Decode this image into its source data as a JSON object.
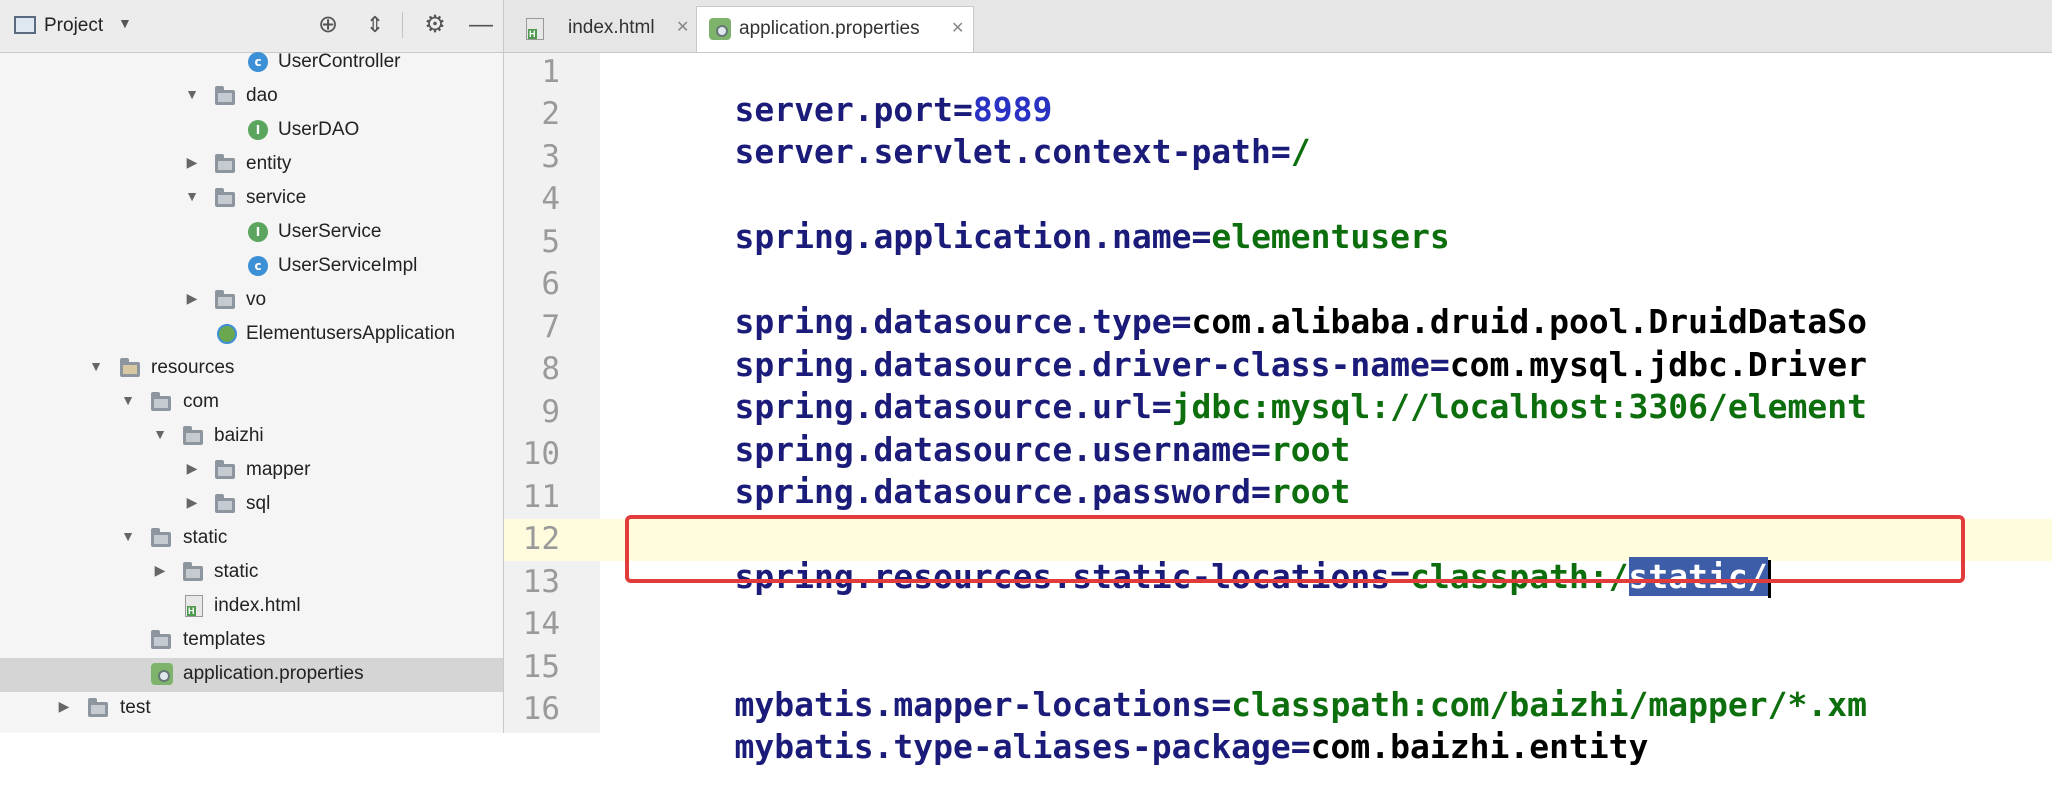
{
  "sidebar": {
    "title": "Project",
    "tree": [
      {
        "label": "UserController",
        "icon": "class-icon",
        "level": 3
      },
      {
        "label": "dao",
        "icon": "folder-icon",
        "level": 2,
        "expanded": true
      },
      {
        "label": "UserDAO",
        "icon": "interface-icon",
        "level": 3
      },
      {
        "label": "entity",
        "icon": "folder-icon",
        "level": 2,
        "expanded": false
      },
      {
        "label": "service",
        "icon": "folder-icon",
        "level": 2,
        "expanded": true
      },
      {
        "label": "UserService",
        "icon": "interface-icon",
        "level": 3
      },
      {
        "label": "UserServiceImpl",
        "icon": "class-icon",
        "level": 3
      },
      {
        "label": "vo",
        "icon": "folder-icon",
        "level": 2,
        "expanded": false
      },
      {
        "label": "ElementusersApplication",
        "icon": "spring-app-icon",
        "level": 2
      },
      {
        "label": "resources",
        "icon": "resources-folder-icon",
        "level": 0,
        "expanded": true
      },
      {
        "label": "com",
        "icon": "folder-icon",
        "level": 1,
        "expanded": true
      },
      {
        "label": "baizhi",
        "icon": "folder-icon",
        "level": 2,
        "expanded": true
      },
      {
        "label": "mapper",
        "icon": "folder-icon",
        "level": 3,
        "expanded": false
      },
      {
        "label": "sql",
        "icon": "folder-icon",
        "level": 3,
        "expanded": false
      },
      {
        "label": "static",
        "icon": "folder-icon",
        "level": 1,
        "expanded": true
      },
      {
        "label": "static",
        "icon": "folder-icon",
        "level": 2,
        "expanded": false
      },
      {
        "label": "index.html",
        "icon": "html-file-icon",
        "level": 2
      },
      {
        "label": "templates",
        "icon": "folder-icon",
        "level": 1
      },
      {
        "label": "application.properties",
        "icon": "properties-file-icon",
        "level": 1,
        "selected": true
      },
      {
        "label": "test",
        "icon": "folder-icon",
        "level": -1,
        "expanded": false
      }
    ]
  },
  "tabs": [
    {
      "label": "index.html",
      "active": false
    },
    {
      "label": "application.properties",
      "active": true
    }
  ],
  "editor": {
    "line_numbers": [
      "1",
      "2",
      "3",
      "4",
      "5",
      "6",
      "7",
      "8",
      "9",
      "10",
      "11",
      "12",
      "13",
      "14",
      "15",
      "16"
    ],
    "lines": {
      "l1": {
        "key": "server.port",
        "eq": "=",
        "val": "8989"
      },
      "l2": {
        "key": "server.servlet.context-path",
        "eq": "=",
        "val": "/"
      },
      "l4": {
        "key": "spring.application.name",
        "eq": "=",
        "val": "elementusers"
      },
      "l6": {
        "key": "spring.datasource.type",
        "eq": "=",
        "val": "com.alibaba.druid.pool.DruidDataSo"
      },
      "l7": {
        "key": "spring.datasource.driver-class-name",
        "eq": "=",
        "val": "com.mysql.jdbc.Driver"
      },
      "l8": {
        "key": "spring.datasource.url",
        "eq": "=",
        "val": "jdbc:mysql://localhost:3306/element"
      },
      "l9": {
        "key": "spring.datasource.username",
        "eq": "=",
        "val": "root"
      },
      "l10": {
        "key": "spring.datasource.password",
        "eq": "=",
        "val": "root"
      },
      "l12": {
        "key": "spring.resources.static-locations",
        "eq": "=",
        "val_plain": "classpath:/",
        "val_selected": "static/"
      },
      "l15": {
        "key": "mybatis.mapper-locations",
        "eq": "=",
        "val": "classpath:com/baizhi/mapper/*.xm"
      },
      "l16": {
        "key": "mybatis.type-aliases-package",
        "eq": "=",
        "val": "com.baizhi.entity"
      }
    }
  },
  "colors": {
    "key": "#1b1b7a",
    "value": "#0d6e0d",
    "number": "#2a32c4",
    "selection": "#3e5da8",
    "highlight_box": "#e23b3b"
  }
}
